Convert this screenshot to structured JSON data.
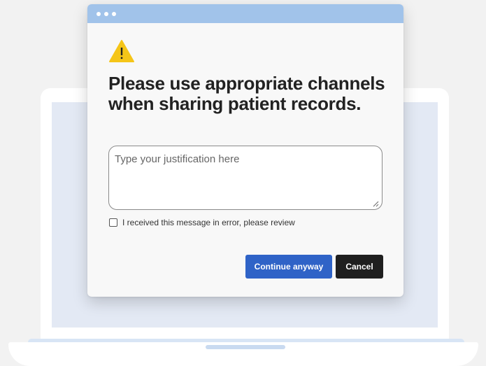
{
  "dialog": {
    "heading": "Please use appropriate channels when sharing patient records.",
    "justification_placeholder": "Type your justification here",
    "justification_value": "",
    "error_checkbox_label": "I received this message in error, please review",
    "error_checkbox_checked": false,
    "continue_label": "Continue anyway",
    "cancel_label": "Cancel",
    "icon": "warning-triangle-icon"
  },
  "colors": {
    "titlebar": "#a1c3ea",
    "warning": "#f5c518",
    "primary_button": "#2f63c7",
    "secondary_button": "#1f1f1f",
    "background": "#f2f2f2",
    "laptop_screen": "#e3e9f4"
  }
}
